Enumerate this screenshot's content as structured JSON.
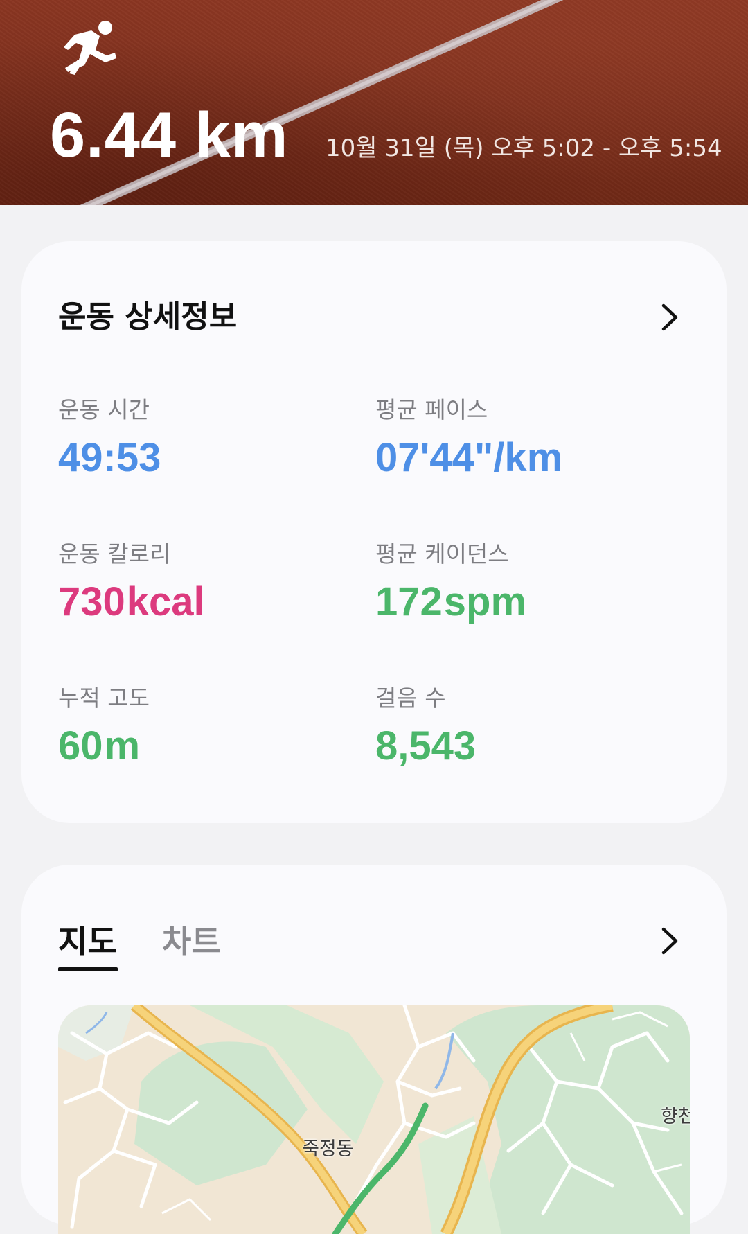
{
  "header": {
    "distance": "6.44 km",
    "datetime": "10월 31일 (목) 오후 5:02 - 오후 5:54",
    "icon": "running-person-icon"
  },
  "details": {
    "title": "운동 상세정보",
    "metrics": [
      {
        "label": "운동 시간",
        "value": "49:53",
        "unit": "",
        "color": "#4e8fe6"
      },
      {
        "label": "평균 페이스",
        "value": "07'44\"/km",
        "unit": "",
        "color": "#4e8fe6"
      },
      {
        "label": "운동 칼로리",
        "value": "730",
        "unit": "kcal",
        "color": "#dc3a7e"
      },
      {
        "label": "평균 케이던스",
        "value": "172",
        "unit": "spm",
        "color": "#4bb66a"
      },
      {
        "label": "누적 고도",
        "value": "60",
        "unit": "m",
        "color": "#4bb66a"
      },
      {
        "label": "걸음 수",
        "value": "8,543",
        "unit": "",
        "color": "#4bb66a"
      }
    ]
  },
  "map_section": {
    "tabs": [
      {
        "label": "지도",
        "selected": true
      },
      {
        "label": "차트",
        "selected": false
      }
    ],
    "map_labels": [
      "죽정동",
      "향천"
    ],
    "route_color": "#4bb66a"
  }
}
